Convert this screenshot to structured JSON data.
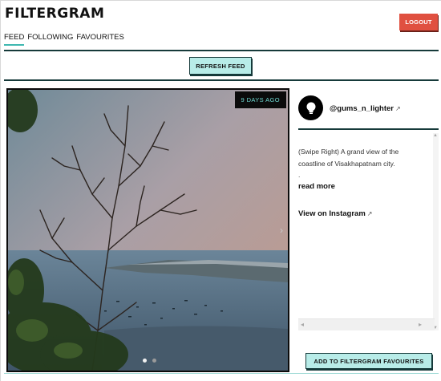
{
  "app": {
    "title": "FILTERGRAM"
  },
  "header": {
    "logout_label": "LOGOUT",
    "tabs": [
      {
        "label": "FEED",
        "active": true
      },
      {
        "label": "FOLLOWING",
        "active": false
      },
      {
        "label": "FAVOURITES",
        "active": false
      }
    ]
  },
  "toolbar": {
    "refresh_label": "REFRESH FEED"
  },
  "post": {
    "age": "9 DAYS AGO",
    "username": "@gums_n_lighter",
    "caption_line1": "(Swipe Right) A grand view of the",
    "caption_line2": "coastline of Visakhapatnam city.",
    "caption_line3": ".",
    "read_more": "read more",
    "view_on_instagram": "View on Instagram",
    "carousel": {
      "slides": 2,
      "current": 1
    },
    "favourite_label": "ADD TO FILTERGRAM FAVOURITES"
  },
  "icons": {
    "external": "external-link-icon",
    "avatar": "lightbulb-icon",
    "next": "chevron-right-icon"
  },
  "colors": {
    "accent": "#3fb8b0",
    "button_fill": "#b8ece8",
    "logout": "#e05040",
    "dark_rule": "#163a3a",
    "badge_text": "#6fd9d2"
  }
}
